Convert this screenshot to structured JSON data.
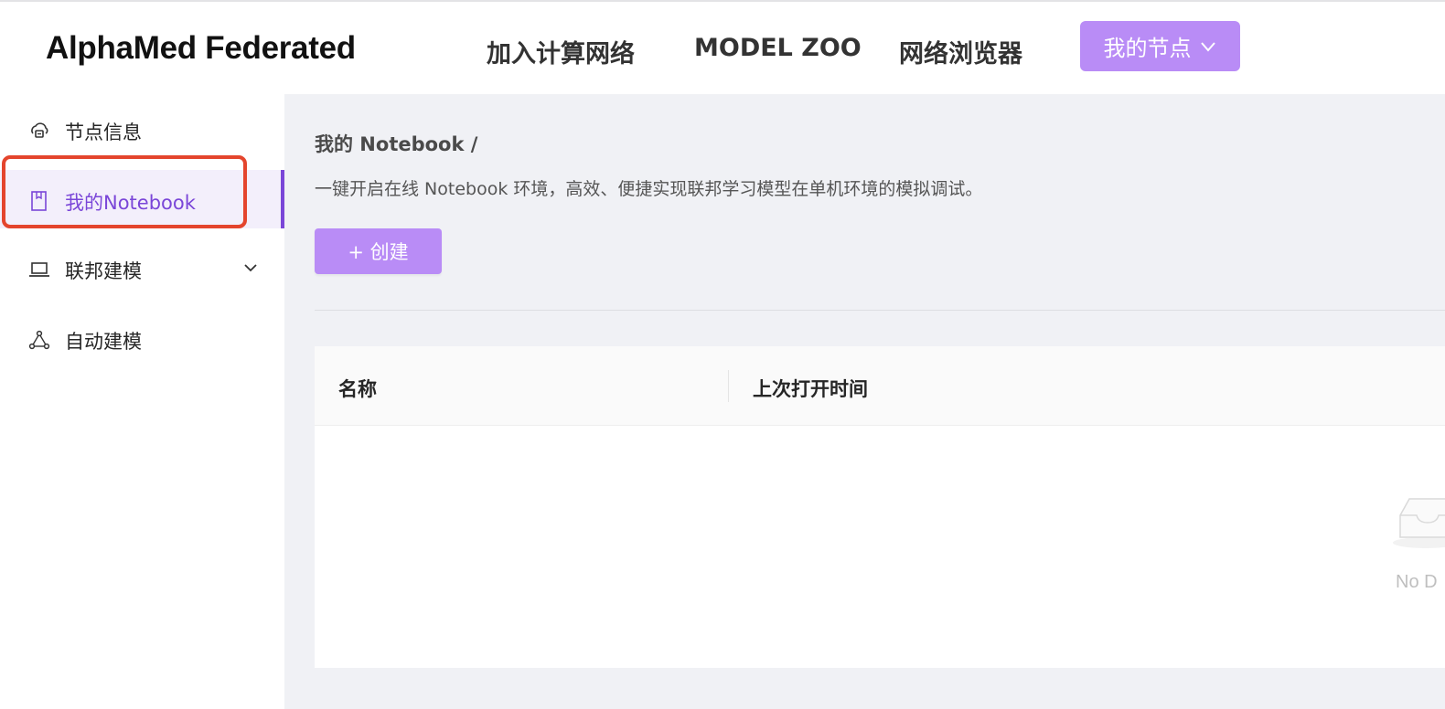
{
  "header": {
    "logo": "AlphaMed Federated",
    "nav": [
      "加入计算网络",
      "MODEL ZOO",
      "网络浏览器"
    ],
    "my_node_button": "我的节点"
  },
  "sidebar": {
    "items": [
      {
        "label": "节点信息",
        "icon": "node-cloud-icon"
      },
      {
        "label": "我的Notebook",
        "icon": "notebook-icon",
        "active": true
      },
      {
        "label": "联邦建模",
        "icon": "laptop-icon",
        "expandable": true
      },
      {
        "label": "自动建模",
        "icon": "network-nodes-icon"
      }
    ]
  },
  "main": {
    "breadcrumb": "我的 Notebook /",
    "description": "一键开启在线 Notebook 环境，高效、便捷实现联邦学习模型在单机环境的模拟调试。",
    "create_button": "+ 创建",
    "table": {
      "columns": [
        "名称",
        "上次打开时间"
      ],
      "empty_text": "No D"
    }
  },
  "colors": {
    "accent": "#b98cf6",
    "active_text": "#7a46d8",
    "highlight": "#e4452d"
  }
}
